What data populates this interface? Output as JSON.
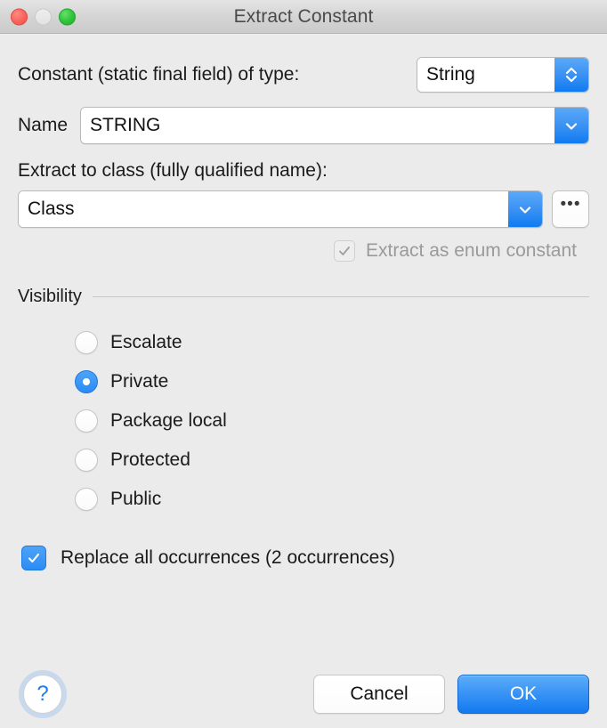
{
  "window": {
    "title": "Extract Constant",
    "traffic_lights": {
      "close": "close-button",
      "minimize": "minimize-button",
      "zoom": "zoom-button"
    }
  },
  "type_row": {
    "label": "Constant (static final field) of type:",
    "value": "String",
    "control": "stepper"
  },
  "name_row": {
    "label": "Name",
    "value": "STRING",
    "control": "combo-box"
  },
  "class_row": {
    "label": "Extract to class (fully qualified name):",
    "value": "Class",
    "browse_label": "•••"
  },
  "enum_row": {
    "label": "Extract as enum constant",
    "checked": true,
    "enabled": false
  },
  "visibility": {
    "title": "Visibility",
    "selected": "Private",
    "options": [
      {
        "label": "Escalate",
        "selected": false
      },
      {
        "label": "Private",
        "selected": true
      },
      {
        "label": "Package local",
        "selected": false
      },
      {
        "label": "Protected",
        "selected": false
      },
      {
        "label": "Public",
        "selected": false
      }
    ]
  },
  "replace_row": {
    "label": "Replace all occurrences (2 occurrences)",
    "checked": true,
    "occurrences": 2
  },
  "footer": {
    "help_label": "?",
    "cancel_label": "Cancel",
    "ok_label": "OK"
  },
  "colors": {
    "background": "#ebebeb",
    "titlebar_top": "#e4e4e4",
    "titlebar_bottom": "#cbcbcb",
    "accent_blue": "#2b8cf5",
    "ok_blue_top": "#5cadf9",
    "ok_blue_bottom": "#1279ef",
    "disabled_text": "#9a9a9a",
    "text": "#1a1a1a",
    "title_text": "#4a4a4a",
    "close_red": "#f8645c",
    "zoom_green": "#2fc23a"
  }
}
